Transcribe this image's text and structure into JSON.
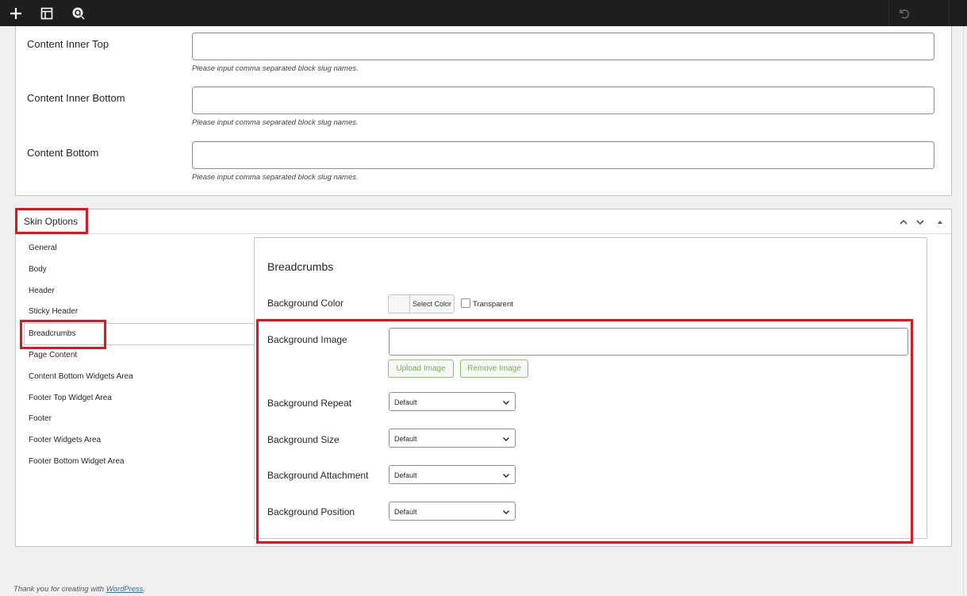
{
  "toolbar": {
    "icons": [
      "plus-icon",
      "layout-icon",
      "badge-icon",
      "undo-icon"
    ]
  },
  "slug_fields": [
    {
      "label": "Content Inner Top",
      "value": "",
      "description": "Please input comma separated block slug names."
    },
    {
      "label": "Content Inner Bottom",
      "value": "",
      "description": "Please input comma separated block slug names."
    },
    {
      "label": "Content Bottom",
      "value": "",
      "description": "Please input comma separated block slug names."
    }
  ],
  "skin_options": {
    "title": "Skin Options",
    "nav": [
      "General",
      "Body",
      "Header",
      "Sticky Header",
      "Breadcrumbs",
      "Page Content",
      "Content Bottom Widgets Area",
      "Footer Top Widget Area",
      "Footer",
      "Footer Widgets Area",
      "Footer Bottom Widget Area"
    ],
    "active_index": 4
  },
  "breadcrumbs": {
    "title": "Breadcrumbs",
    "background_color": {
      "label": "Background Color",
      "button": "Select Color",
      "transparent_label": "Transparent",
      "transparent_checked": false
    },
    "background_image": {
      "label": "Background Image",
      "value": "",
      "upload_label": "Upload Image",
      "remove_label": "Remove Image"
    },
    "selects": [
      {
        "label": "Background Repeat",
        "value": "Default"
      },
      {
        "label": "Background Size",
        "value": "Default"
      },
      {
        "label": "Background Attachment",
        "value": "Default"
      },
      {
        "label": "Background Position",
        "value": "Default"
      }
    ]
  },
  "footer": {
    "text": "Thank you for creating with ",
    "link": "WordPress",
    "suffix": "."
  },
  "colors": {
    "highlight": "#e0151f",
    "toolbar": "#1e1e1e",
    "green_button": "#7aad4e",
    "link": "#2271b1"
  }
}
